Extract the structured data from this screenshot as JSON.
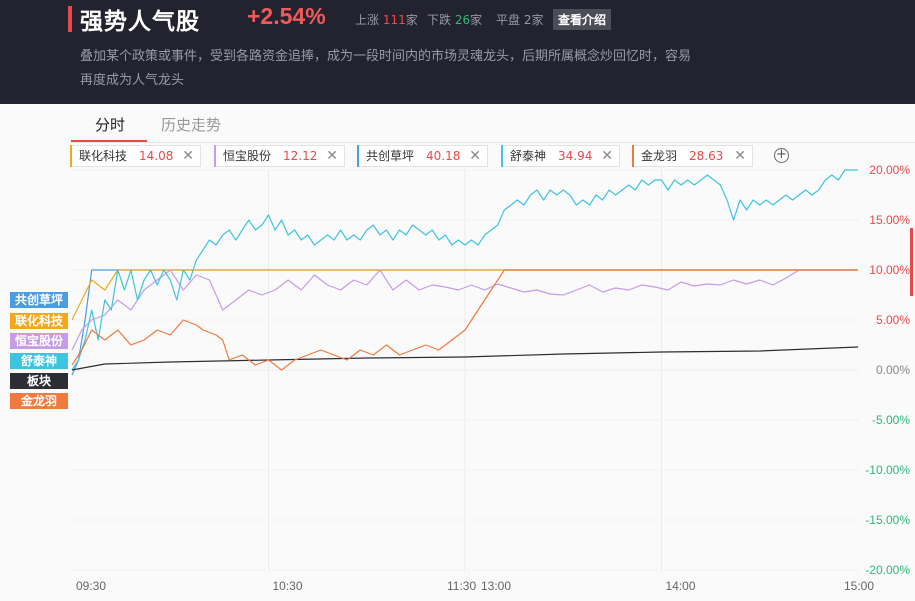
{
  "header": {
    "title": "强势人气股",
    "change_pct": "+2.54%",
    "stats": {
      "up_label": "上涨",
      "up_count": "111",
      "up_unit": "家",
      "down_label": "下跌",
      "down_count": "26",
      "down_unit": "家",
      "flat_label": "平盘",
      "flat_count": "2",
      "flat_unit": "家"
    },
    "intro_button": "查看介绍",
    "description": "叠加某个政策或事件，受到各路资金追捧，成为一段时间内的市场灵魂龙头，后期所属概念炒回忆时，容易再度成为人气龙头"
  },
  "tabs": [
    {
      "label": "分时",
      "active": true
    },
    {
      "label": "历史走势",
      "active": false
    }
  ],
  "stock_chips": [
    {
      "name": "联化科技",
      "price": "14.08",
      "color": "#f3a81b"
    },
    {
      "name": "恒宝股份",
      "price": "12.12",
      "color": "#c79be8"
    },
    {
      "name": "共创草坪",
      "price": "40.18",
      "color": "#4a9de2"
    },
    {
      "name": "舒泰神",
      "price": "34.94",
      "color": "#3fc4e0"
    },
    {
      "name": "金龙羽",
      "price": "28.63",
      "color": "#f07a3e"
    }
  ],
  "add_icon": "plus-circle-icon",
  "close_icon": "close-icon",
  "legend_tags": [
    {
      "label": "共创草坪",
      "color": "#4a9de2"
    },
    {
      "label": "联化科技",
      "color": "#f3a81b"
    },
    {
      "label": "恒宝股份",
      "color": "#c79be8"
    },
    {
      "label": "舒泰神",
      "color": "#3fc4e0"
    },
    {
      "label": "板块",
      "color": "#2d2d35"
    },
    {
      "label": "金龙羽",
      "color": "#f07a3e"
    }
  ],
  "chart_data": {
    "type": "line",
    "y_ticks": [
      "20.00%",
      "15.00%",
      "10.00%",
      "5.00%",
      "0.00%",
      "-5.00%",
      "-10.00%",
      "-15.00%",
      "-20.00%"
    ],
    "ylim": [
      -20,
      20
    ],
    "x_ticks": [
      "09:30",
      "10:30",
      "11:30",
      "13:00",
      "14:00",
      "15:00"
    ],
    "series": [
      {
        "name": "共创草坪",
        "color": "#4a9de2",
        "points": [
          [
            0,
            -0.5
          ],
          [
            2,
            1
          ],
          [
            4,
            5
          ],
          [
            6,
            10
          ],
          [
            30,
            10
          ],
          [
            60,
            10
          ],
          [
            120,
            10
          ],
          [
            180,
            10
          ],
          [
            240,
            10
          ]
        ]
      },
      {
        "name": "联化科技",
        "color": "#f3a81b",
        "points": [
          [
            0,
            5
          ],
          [
            3,
            7
          ],
          [
            6,
            9
          ],
          [
            10,
            8
          ],
          [
            14,
            10
          ],
          [
            20,
            10
          ],
          [
            60,
            10
          ],
          [
            120,
            10
          ],
          [
            180,
            10
          ],
          [
            240,
            10
          ]
        ]
      },
      {
        "name": "恒宝股份",
        "color": "#c79be8",
        "points": [
          [
            0,
            2
          ],
          [
            3,
            4
          ],
          [
            6,
            5
          ],
          [
            10,
            5.5
          ],
          [
            14,
            7
          ],
          [
            18,
            6
          ],
          [
            22,
            8
          ],
          [
            26,
            9
          ],
          [
            30,
            10
          ],
          [
            34,
            8
          ],
          [
            38,
            9.5
          ],
          [
            42,
            9
          ],
          [
            46,
            6
          ],
          [
            50,
            7
          ],
          [
            54,
            8
          ],
          [
            58,
            7.5
          ],
          [
            62,
            8
          ],
          [
            66,
            9
          ],
          [
            70,
            8
          ],
          [
            74,
            9.5
          ],
          [
            78,
            8.5
          ],
          [
            82,
            8
          ],
          [
            86,
            9
          ],
          [
            90,
            8.5
          ],
          [
            94,
            10
          ],
          [
            98,
            8
          ],
          [
            102,
            9
          ],
          [
            106,
            8
          ],
          [
            110,
            8.5
          ],
          [
            114,
            8.3
          ],
          [
            118,
            8
          ],
          [
            122,
            8.5
          ],
          [
            126,
            8
          ],
          [
            130,
            8.6
          ],
          [
            134,
            8.2
          ],
          [
            138,
            7.8
          ],
          [
            142,
            8
          ],
          [
            146,
            7.6
          ],
          [
            150,
            7.5
          ],
          [
            154,
            8
          ],
          [
            158,
            8.5
          ],
          [
            162,
            7.8
          ],
          [
            166,
            8.2
          ],
          [
            170,
            8
          ],
          [
            174,
            8.5
          ],
          [
            178,
            8.3
          ],
          [
            182,
            8
          ],
          [
            186,
            8.8
          ],
          [
            190,
            8.4
          ],
          [
            194,
            8.6
          ],
          [
            198,
            8.5
          ],
          [
            202,
            9
          ],
          [
            206,
            8.6
          ],
          [
            210,
            9
          ],
          [
            214,
            8.5
          ],
          [
            218,
            9.2
          ],
          [
            222,
            10
          ],
          [
            226,
            10
          ],
          [
            240,
            10
          ]
        ]
      },
      {
        "name": "舒泰神",
        "color": "#3fc4e0",
        "points": [
          [
            0,
            0
          ],
          [
            2,
            1
          ],
          [
            4,
            3
          ],
          [
            6,
            6
          ],
          [
            8,
            3
          ],
          [
            10,
            7
          ],
          [
            12,
            6
          ],
          [
            14,
            10
          ],
          [
            16,
            8
          ],
          [
            18,
            10
          ],
          [
            20,
            7
          ],
          [
            22,
            9
          ],
          [
            24,
            10
          ],
          [
            26,
            8.5
          ],
          [
            28,
            10
          ],
          [
            30,
            9
          ],
          [
            32,
            7
          ],
          [
            34,
            10
          ],
          [
            36,
            9
          ],
          [
            38,
            11
          ],
          [
            40,
            12
          ],
          [
            42,
            13
          ],
          [
            44,
            12.5
          ],
          [
            46,
            13.5
          ],
          [
            48,
            14
          ],
          [
            50,
            13
          ],
          [
            52,
            14
          ],
          [
            54,
            15
          ],
          [
            56,
            14
          ],
          [
            58,
            14.5
          ],
          [
            60,
            15.5
          ],
          [
            62,
            14
          ],
          [
            64,
            15
          ],
          [
            66,
            13.5
          ],
          [
            68,
            14
          ],
          [
            70,
            13
          ],
          [
            72,
            13.5
          ],
          [
            74,
            12.5
          ],
          [
            76,
            13
          ],
          [
            78,
            13.5
          ],
          [
            80,
            13
          ],
          [
            82,
            14
          ],
          [
            84,
            13
          ],
          [
            86,
            13.5
          ],
          [
            88,
            13
          ],
          [
            90,
            14
          ],
          [
            92,
            14.5
          ],
          [
            94,
            13.5
          ],
          [
            96,
            14
          ],
          [
            98,
            13
          ],
          [
            100,
            14
          ],
          [
            102,
            13.5
          ],
          [
            104,
            14.5
          ],
          [
            106,
            14
          ],
          [
            108,
            13.5
          ],
          [
            110,
            14
          ],
          [
            112,
            13
          ],
          [
            114,
            13.5
          ],
          [
            116,
            12.5
          ],
          [
            118,
            13
          ],
          [
            120,
            12.5
          ],
          [
            122,
            13
          ],
          [
            124,
            12.5
          ],
          [
            126,
            13.5
          ],
          [
            128,
            14
          ],
          [
            130,
            14.5
          ],
          [
            132,
            16
          ],
          [
            134,
            16.5
          ],
          [
            136,
            17
          ],
          [
            138,
            16.5
          ],
          [
            140,
            17.5
          ],
          [
            142,
            18
          ],
          [
            144,
            17
          ],
          [
            146,
            18
          ],
          [
            148,
            17.5
          ],
          [
            150,
            18
          ],
          [
            152,
            17.5
          ],
          [
            154,
            16.5
          ],
          [
            156,
            17
          ],
          [
            158,
            16.5
          ],
          [
            160,
            17.5
          ],
          [
            162,
            17
          ],
          [
            164,
            18
          ],
          [
            166,
            17.5
          ],
          [
            168,
            18
          ],
          [
            170,
            18.5
          ],
          [
            172,
            18
          ],
          [
            174,
            19
          ],
          [
            176,
            18.5
          ],
          [
            178,
            19
          ],
          [
            180,
            19
          ],
          [
            182,
            18
          ],
          [
            184,
            19
          ],
          [
            186,
            18.5
          ],
          [
            188,
            19
          ],
          [
            190,
            18.5
          ],
          [
            192,
            19
          ],
          [
            194,
            19.5
          ],
          [
            196,
            19
          ],
          [
            198,
            18.5
          ],
          [
            200,
            17
          ],
          [
            202,
            15
          ],
          [
            204,
            17
          ],
          [
            206,
            16
          ],
          [
            208,
            17
          ],
          [
            210,
            16.5
          ],
          [
            212,
            17
          ],
          [
            214,
            16.5
          ],
          [
            216,
            17
          ],
          [
            218,
            17.5
          ],
          [
            220,
            17
          ],
          [
            222,
            17.5
          ],
          [
            224,
            18
          ],
          [
            226,
            17.5
          ],
          [
            228,
            18
          ],
          [
            230,
            19
          ],
          [
            232,
            19.5
          ],
          [
            234,
            19
          ],
          [
            236,
            20
          ],
          [
            240,
            20
          ]
        ]
      },
      {
        "name": "板块",
        "color": "#2d2d35",
        "points": [
          [
            0,
            0
          ],
          [
            10,
            0.6
          ],
          [
            30,
            0.8
          ],
          [
            60,
            1.0
          ],
          [
            90,
            1.2
          ],
          [
            120,
            1.3
          ],
          [
            150,
            1.6
          ],
          [
            180,
            1.8
          ],
          [
            210,
            1.9
          ],
          [
            240,
            2.3
          ]
        ]
      },
      {
        "name": "金龙羽",
        "color": "#f07a3e",
        "points": [
          [
            0,
            0.5
          ],
          [
            3,
            2
          ],
          [
            6,
            4
          ],
          [
            10,
            3
          ],
          [
            14,
            4
          ],
          [
            18,
            2.5
          ],
          [
            22,
            3
          ],
          [
            26,
            4
          ],
          [
            30,
            3.5
          ],
          [
            34,
            5
          ],
          [
            38,
            4.5
          ],
          [
            40,
            4
          ],
          [
            44,
            3.5
          ],
          [
            46,
            3
          ],
          [
            48,
            1
          ],
          [
            52,
            1.5
          ],
          [
            56,
            0.5
          ],
          [
            60,
            1
          ],
          [
            64,
            0
          ],
          [
            68,
            1
          ],
          [
            72,
            1.5
          ],
          [
            76,
            2
          ],
          [
            80,
            1.5
          ],
          [
            84,
            1
          ],
          [
            88,
            2
          ],
          [
            92,
            1.5
          ],
          [
            96,
            2.5
          ],
          [
            100,
            1.5
          ],
          [
            104,
            2
          ],
          [
            108,
            2.5
          ],
          [
            112,
            2
          ],
          [
            116,
            3
          ],
          [
            120,
            4
          ],
          [
            124,
            6
          ],
          [
            128,
            8
          ],
          [
            132,
            10
          ],
          [
            136,
            10
          ],
          [
            180,
            10
          ],
          [
            240,
            10
          ]
        ]
      }
    ]
  }
}
